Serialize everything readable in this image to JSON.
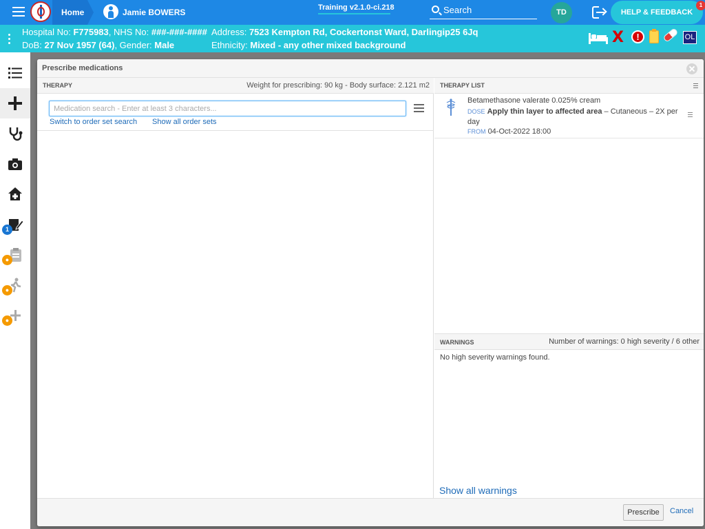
{
  "topbar": {
    "home_label": "Home",
    "patient_name": "Jamie BOWERS",
    "environment": "Training v2.1.0-ci.218",
    "search_label": "Search",
    "user_initials": "TD",
    "help_label": "HELP & FEEDBACK",
    "help_badge": "1"
  },
  "banner": {
    "hospital_label": "Hospital No:",
    "hospital_no": "F775983",
    "nhs_label": ", NHS No:",
    "nhs_no": "###-###-####",
    "address_label": "Address:",
    "address": "7523 Kempton Rd, Cockertonst Ward, Darlingip25 6Jq",
    "dob_label": "DoB:",
    "dob": "27 Nov 1957 (64)",
    "gender_label": ", Gender:",
    "gender": "Male",
    "ethnicity_label": "Ethnicity:",
    "ethnicity": "Mixed - any other mixed background",
    "ol_badge": "OL",
    "alert_mark": "!",
    "x_mark": "X"
  },
  "sidebar": {
    "items": [
      {
        "icon": "list-icon"
      },
      {
        "icon": "plus-icon"
      },
      {
        "icon": "stethoscope-icon"
      },
      {
        "icon": "camera-icon"
      },
      {
        "icon": "home-medical-icon"
      },
      {
        "icon": "edit-document-icon",
        "badge": "1"
      },
      {
        "icon": "clipboard-icon",
        "locked": true
      },
      {
        "icon": "walking-icon",
        "locked": true
      },
      {
        "icon": "add-locked-icon",
        "locked": true
      }
    ]
  },
  "modal": {
    "title": "Prescribe medications",
    "therapy": {
      "title": "THERAPY",
      "meta": "Weight for prescribing: 90 kg - Body surface: 2.121 m2",
      "search_placeholder": "Medication search - Enter at least 3 characters...",
      "search_value": "",
      "link_order_set": "Switch to order set search",
      "link_all_sets": "Show all order sets"
    },
    "therapy_list": {
      "title": "THERAPY LIST",
      "items": [
        {
          "name": "Betamethasone valerate 0.025% cream",
          "dose_tag": "DOSE",
          "dose_text": "Apply thin layer to affected area",
          "dose_rest": " – Cutaneous – 2X per day",
          "from_tag": "FROM",
          "from_date": "04-Oct-2022 18:00"
        }
      ]
    },
    "warnings": {
      "title": "WARNINGS",
      "summary": "Number of warnings: 0 high severity / 6 other",
      "message": "No high severity warnings found.",
      "show_all": "Show all warnings"
    },
    "footer": {
      "prescribe_label": "Prescribe",
      "cancel_label": "Cancel"
    }
  },
  "colors": {
    "topbar": "#1e88e5",
    "banner": "#26c6da",
    "link": "#1e6bb8",
    "locked_badge": "#f59a00",
    "count_badge": "#1976d2"
  }
}
